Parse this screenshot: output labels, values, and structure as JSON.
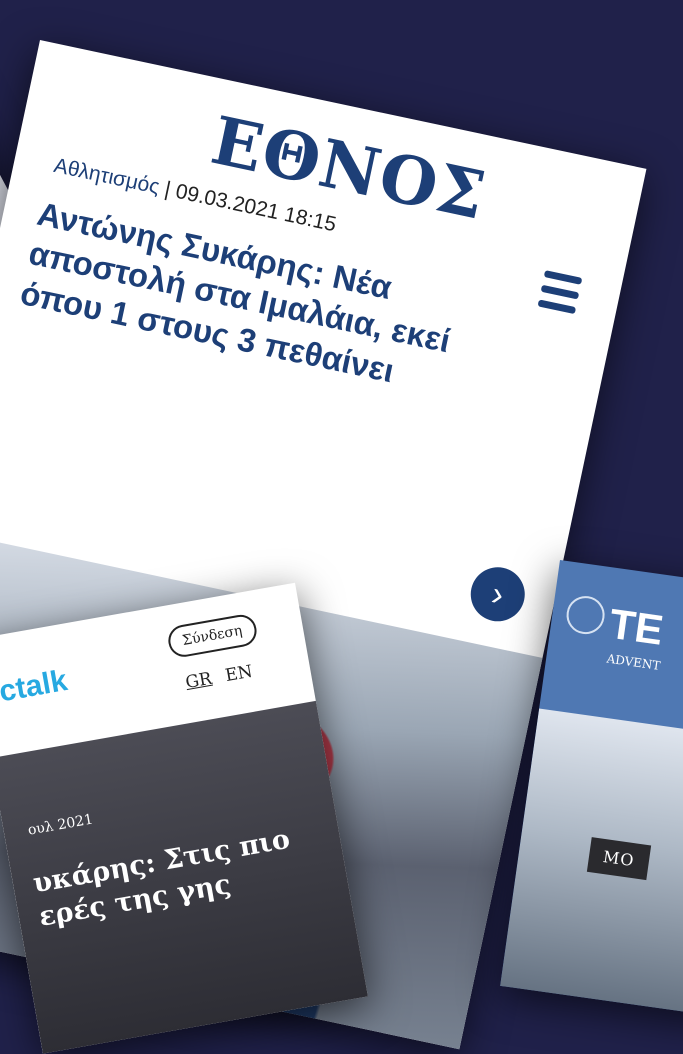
{
  "main_card": {
    "logo": "ΕΘΝΟΣ",
    "category": "Αθλητισμός",
    "separator": " | ",
    "datetime": "09.03.2021 18:15",
    "headline": "Αντώνης Συκάρης: Νέα αποστολή στα Ιμαλάια, εκεί όπου 1 στους 3 πεθαίνει",
    "next_glyph": "›"
  },
  "bottom_left_card": {
    "logo": "ctalk",
    "login_label": "Σύνδεση",
    "lang_gr": "GR",
    "lang_en": "EN",
    "date_fragment": "ουλ 2021",
    "headline_fragment": "υκάρης: Στις πιο\nερές της γης"
  },
  "bottom_right_card": {
    "logo_fragment": "TE",
    "subtitle_fragment": "ADVENT",
    "more_label": "MO"
  },
  "colors": {
    "background": "#20214a",
    "brand_blue": "#1d3f77",
    "ctalk_blue": "#27a9e1"
  }
}
